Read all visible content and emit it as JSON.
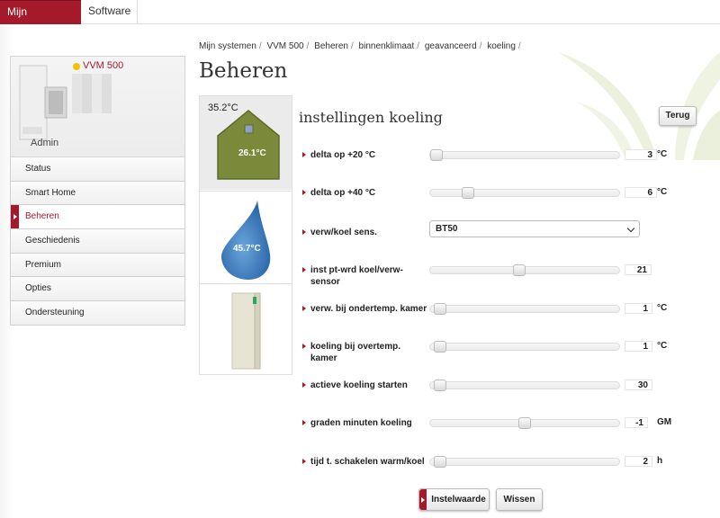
{
  "topnav": {
    "mine": "Mijn systemen",
    "software": "Software"
  },
  "device": {
    "name": "VVM 500",
    "user": "Admin"
  },
  "menu": [
    {
      "label": "Status"
    },
    {
      "label": "Smart Home"
    },
    {
      "label": "Beheren"
    },
    {
      "label": "Geschiedenis"
    },
    {
      "label": "Premium"
    },
    {
      "label": "Opties"
    },
    {
      "label": "Ondersteuning"
    }
  ],
  "breadcrumb": [
    "Mijn systemen",
    "VVM 500",
    "Beheren",
    "binnenklimaat",
    "geavanceerd",
    "koeling"
  ],
  "page_title": "Beheren",
  "temps": {
    "outdoor": "35.2°C",
    "indoor": "26.1°C",
    "water": "45.7°C"
  },
  "section_title": "instellingen koeling",
  "back_label": "Terug",
  "settings": [
    {
      "label": "delta op +20 °C",
      "value": "3",
      "unit": "°C",
      "level": 0.0
    },
    {
      "label": "delta op +40 °C",
      "value": "6",
      "unit": "°C",
      "level": 0.18
    },
    {
      "label": "verw/koel sens.",
      "select": "BT50"
    },
    {
      "label": "inst pt-wrd koel/verw-sensor",
      "value": "21",
      "unit": "",
      "level": 0.47
    },
    {
      "label": "verw. bij ondertemp. kamer",
      "value": "1",
      "unit": "°C",
      "level": 0.02
    },
    {
      "label": "koeling bij overtemp. kamer",
      "value": "1",
      "unit": "°C",
      "level": 0.02
    },
    {
      "label": "actieve koeling starten",
      "value": "30",
      "unit": "",
      "level": 0.02
    },
    {
      "label": "graden minuten koeling",
      "value": "-1",
      "unit": "GM",
      "level": 0.5
    },
    {
      "label": "tijd t. schakelen warm/koel",
      "value": "2",
      "unit": "h",
      "level": 0.02
    }
  ],
  "buttons": {
    "set": "Instelwaarde",
    "clear": "Wissen"
  },
  "colors": {
    "accent": "#a41a2a",
    "house": "#7b8a3a",
    "drop": "#3a78b8"
  }
}
